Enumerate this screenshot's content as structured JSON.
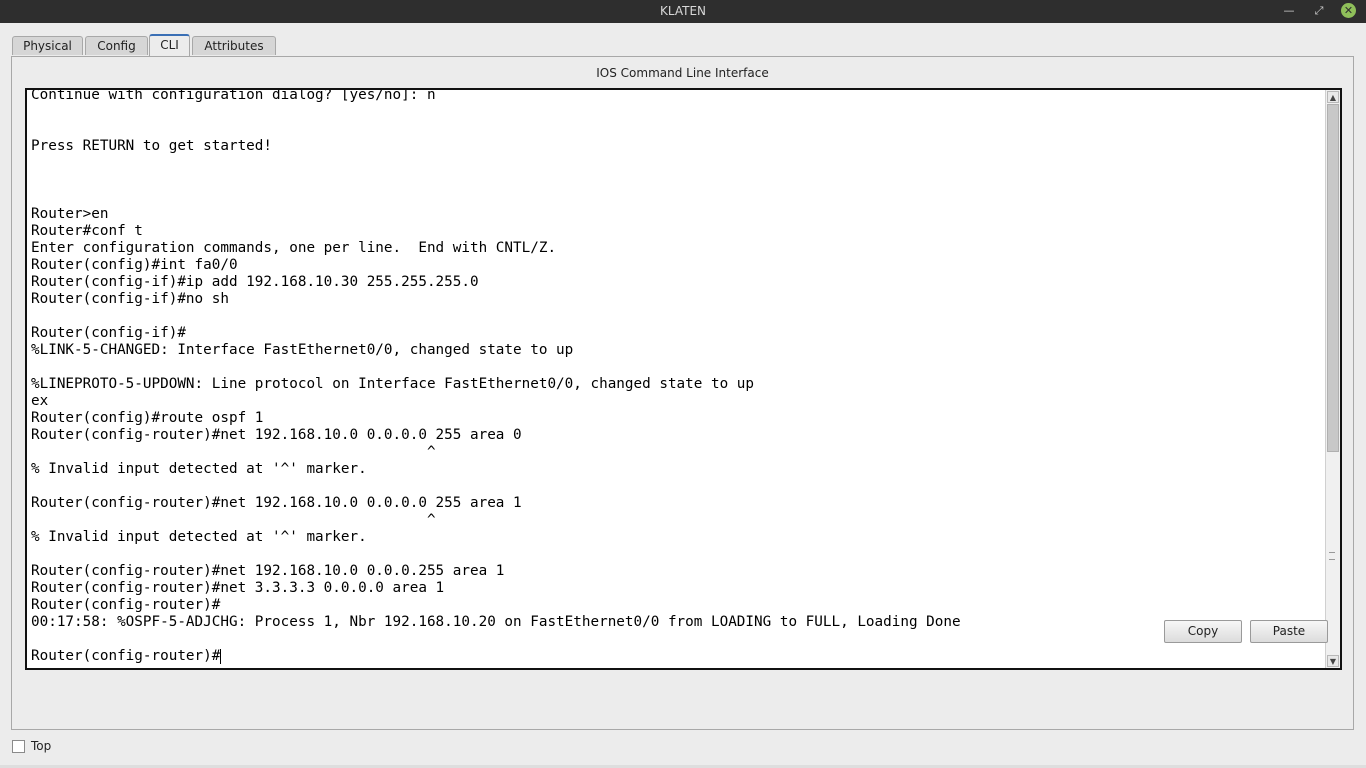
{
  "window": {
    "title": "KLATEN",
    "minimize_glyph": "—",
    "maximize_glyph": "⤢",
    "close_glyph": "✕"
  },
  "tabs": [
    {
      "label": "Physical"
    },
    {
      "label": "Config"
    },
    {
      "label": "CLI",
      "active": true
    },
    {
      "label": "Attributes"
    }
  ],
  "panel": {
    "title": "IOS Command Line Interface"
  },
  "console": {
    "lines": [
      "Continue with configuration dialog? [yes/no]: n",
      "",
      "",
      "Press RETURN to get started!",
      "",
      "",
      "",
      "Router>en",
      "Router#conf t",
      "Enter configuration commands, one per line.  End with CNTL/Z.",
      "Router(config)#int fa0/0",
      "Router(config-if)#ip add 192.168.10.30 255.255.255.0",
      "Router(config-if)#no sh",
      "",
      "Router(config-if)#",
      "%LINK-5-CHANGED: Interface FastEthernet0/0, changed state to up",
      "",
      "%LINEPROTO-5-UPDOWN: Line protocol on Interface FastEthernet0/0, changed state to up",
      "ex",
      "Router(config)#route ospf 1",
      "Router(config-router)#net 192.168.10.0 0.0.0.0 255 area 0",
      "                                              ^",
      "% Invalid input detected at '^' marker.",
      "",
      "Router(config-router)#net 192.168.10.0 0.0.0.0 255 area 1",
      "                                              ^",
      "% Invalid input detected at '^' marker.",
      "",
      "Router(config-router)#net 192.168.10.0 0.0.0.255 area 1",
      "Router(config-router)#net 3.3.3.3 0.0.0.0 area 1",
      "Router(config-router)#",
      "00:17:58: %OSPF-5-ADJCHG: Process 1, Nbr 192.168.10.20 on FastEthernet0/0 from LOADING to FULL, Loading Done",
      "",
      "Router(config-router)#"
    ]
  },
  "buttons": {
    "copy_label": "Copy",
    "paste_label": "Paste"
  },
  "top_checkbox": {
    "label": "Top",
    "checked": false
  },
  "icons": {
    "scroll_up": "▲",
    "scroll_down": "▼"
  }
}
